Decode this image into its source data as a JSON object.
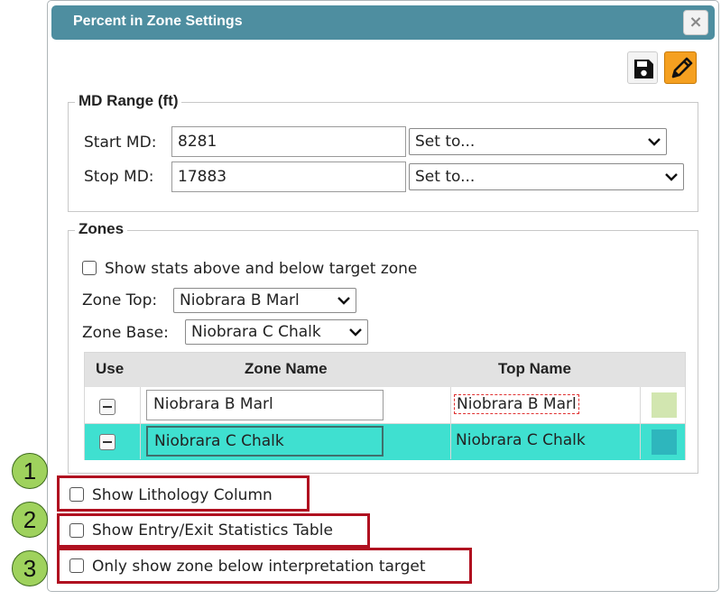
{
  "dialog": {
    "title": "Percent in Zone Settings",
    "close_label": "×"
  },
  "md_range": {
    "legend": "MD Range (ft)",
    "start_label": "Start MD:",
    "start_value": "8281",
    "start_select": "Set to...",
    "stop_label": "Stop MD:",
    "stop_value": "17883",
    "stop_select": "Set to..."
  },
  "zones": {
    "legend": "Zones",
    "show_stats_label": "Show stats above and below target zone",
    "zone_top_label": "Zone Top:",
    "zone_top_value": "Niobrara B Marl",
    "zone_base_label": "Zone Base:",
    "zone_base_value": "Niobrara C Chalk",
    "table": {
      "headers": [
        "Use",
        "Zone Name",
        "Top Name"
      ],
      "rows": [
        {
          "zone_name": "Niobrara B Marl",
          "top_name": "Niobrara B Marl",
          "color": "#d2e6b0"
        },
        {
          "zone_name": "Niobrara C Chalk",
          "top_name": "Niobrara C Chalk",
          "color": "#2eb6bd"
        }
      ]
    }
  },
  "options": [
    {
      "number": "1",
      "label": "Show Lithology Column"
    },
    {
      "number": "2",
      "label": "Show Entry/Exit Statistics Table"
    },
    {
      "number": "3",
      "label": "Only show zone below interpretation target"
    }
  ],
  "colors": {
    "titlebar": "#4e8ea0",
    "edit_accent": "#f5a020",
    "selected_row": "#3fe0d0",
    "highlight_box": "#b01020",
    "callout_badge": "#9fd25d"
  },
  "icons": {
    "save": "floppy-disk-icon",
    "edit": "pencil-icon",
    "close": "close-icon"
  }
}
